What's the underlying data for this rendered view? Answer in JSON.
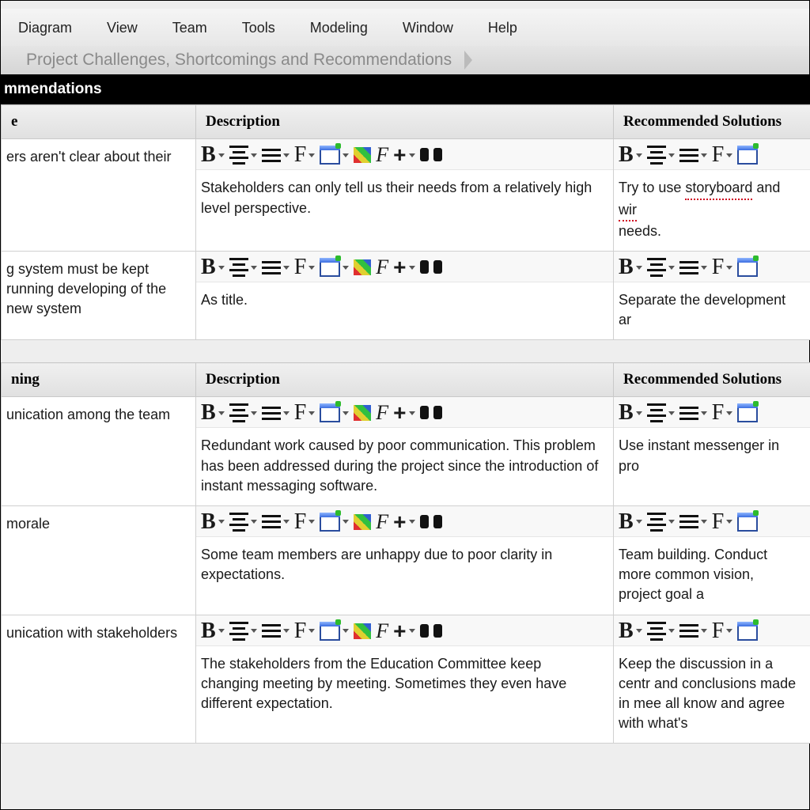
{
  "menu": [
    "Diagram",
    "View",
    "Team",
    "Tools",
    "Modeling",
    "Window",
    "Help"
  ],
  "breadcrumb": "Project Challenges, Shortcomings and Recommendations",
  "titlebar_tail": "mmendations",
  "table1": {
    "headers": {
      "a": "e",
      "b": "Description",
      "c": "Recommended Solutions"
    },
    "rows": [
      {
        "a": "ers aren't clear about their",
        "b": "Stakeholders can only tell us their needs from a relatively high level perspective.",
        "c_pre": "Try to use ",
        "c_w1": "storyboard",
        "c_mid": " and ",
        "c_w2": "wir",
        "c_post": " needs."
      },
      {
        "a": "g system must be kept running developing of the new system",
        "b": "As title.",
        "c": "Separate the development ar"
      }
    ]
  },
  "table2": {
    "headers": {
      "a": "ning",
      "b": "Description",
      "c": "Recommended Solutions"
    },
    "rows": [
      {
        "a": "unication among the team",
        "b": "Redundant work caused by poor communication. This problem has been addressed during the project since the introduction of instant messaging software.",
        "c": "Use instant messenger in pro"
      },
      {
        "a": "morale",
        "b": "Some team members are unhappy due to poor clarity in expectations.",
        "c": "Team building. Conduct more common vision, project goal a"
      },
      {
        "a": "unication with stakeholders",
        "b": "The stakeholders from the Education Committee keep changing meeting by meeting. Sometimes they even have different expectation.",
        "c": "Keep the discussion in a centr and conclusions made in mee all know and agree with what's"
      }
    ]
  }
}
